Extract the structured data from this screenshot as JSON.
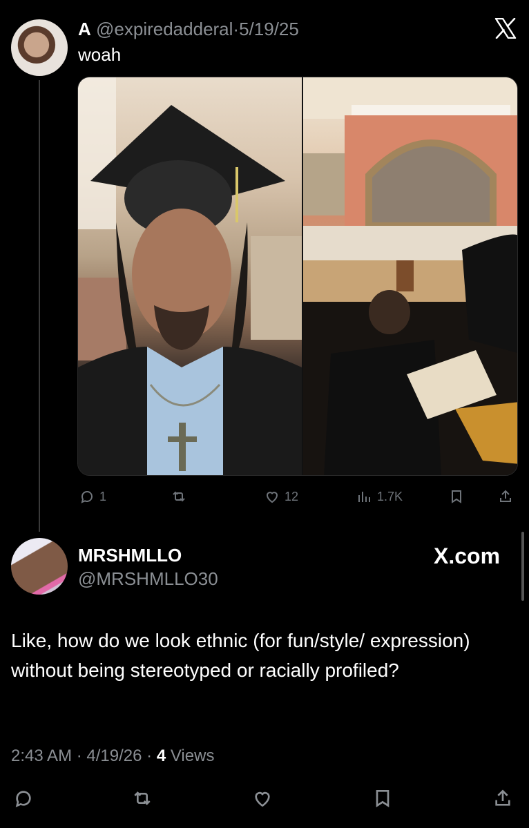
{
  "quoted_post": {
    "display_name": "A",
    "handle": "@expiredadderal",
    "separator": "·",
    "date": "5/19/25",
    "text": "woah",
    "replies": "1",
    "likes": "12",
    "views": "1.7K"
  },
  "main_post": {
    "display_name": "MRSHMLLO",
    "handle": "@MRSHMLLO30",
    "brand_label": "X.com",
    "text": "Like, how do we look ethnic (for fun/style/ expression) without being stereotyped or racially profiled?",
    "time": "2:43 AM",
    "separator": "·",
    "date": "4/19/26",
    "views_count": "4",
    "views_label": "Views"
  },
  "colors": {
    "background": "#000000",
    "text_primary": "#ffffff",
    "text_secondary": "#8b8f94",
    "icon_gray": "#6f747a"
  }
}
